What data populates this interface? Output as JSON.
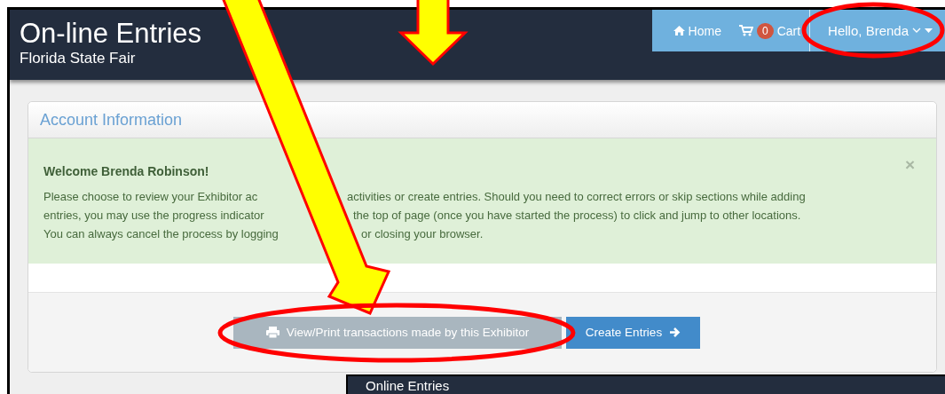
{
  "header": {
    "title": "On-line Entries",
    "subtitle": "Florida State Fair"
  },
  "nav": [
    {
      "kind": "home",
      "label": "Home"
    },
    {
      "kind": "cart",
      "label": "Cart",
      "badge": "0"
    },
    {
      "kind": "user",
      "label": "Hello, Brenda"
    }
  ],
  "panel": {
    "title": "Account Information",
    "alert": {
      "heading": "Welcome Brenda Robinson!",
      "lines": [
        [
          "Please choose to review your Exhibitor ac",
          "activities or create entries. Should you need to correct errors or skip sections while adding"
        ],
        [
          "entries, you may use the progress indicator",
          "the top of page (once you have started the process) to click and jump to other locations."
        ],
        [
          "You can always cancel the process by logging",
          "or closing your browser."
        ]
      ],
      "close": "×"
    },
    "buttons": [
      {
        "kind": "print",
        "label": "View/Print transactions made by this Exhibitor"
      },
      {
        "kind": "next",
        "label": "Create Entries"
      }
    ]
  },
  "second_window": {
    "title": "Online Entries"
  }
}
